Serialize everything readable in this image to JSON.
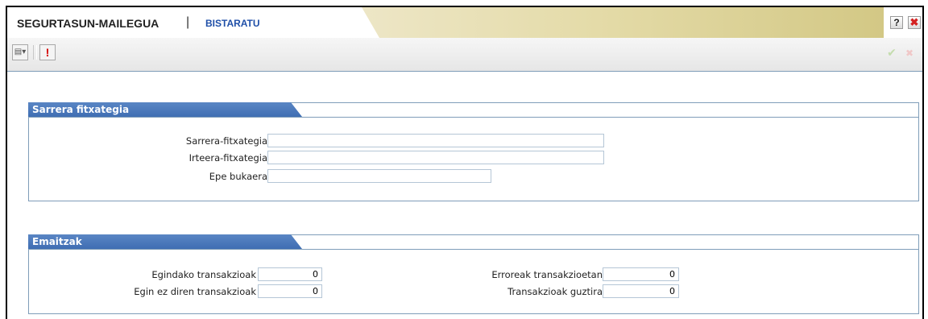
{
  "header": {
    "app_title": "SEGURTASUN-MAILEGUA",
    "separator": "|",
    "mode": "BISTARATU",
    "help_label": "?",
    "close_label": "✖"
  },
  "toolbar": {
    "dropdown_glyph": "▤▾",
    "error_glyph": "!",
    "ok_glyph": "✔",
    "cancel_glyph": "✖"
  },
  "sections": {
    "input_file": {
      "title": "Sarrera fitxategia",
      "fields": {
        "input_file": {
          "label": "Sarrera-fitxategia",
          "value": ""
        },
        "output_file": {
          "label": "Irteera-fitxategia",
          "value": ""
        },
        "deadline": {
          "label": "Epe bukaera",
          "value": ""
        }
      }
    },
    "results": {
      "title": "Emaitzak",
      "fields": {
        "done": {
          "label": "Egindako transakzioak",
          "value": "0"
        },
        "not_done": {
          "label": "Egin ez diren transakzioak",
          "value": "0"
        },
        "errors": {
          "label": "Erroreak transakzioetan",
          "value": "0"
        },
        "total": {
          "label": "Transakzioak guztira",
          "value": "0"
        }
      }
    }
  }
}
